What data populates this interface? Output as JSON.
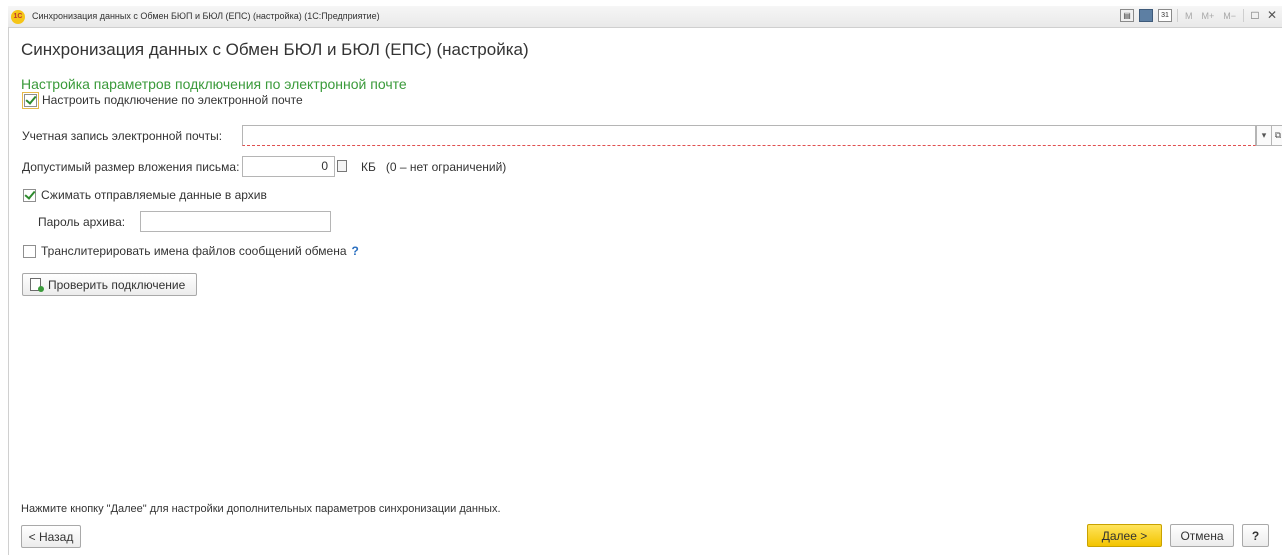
{
  "window": {
    "title": "Синхронизация данных с Обмен БЮП и БЮЛ (ЕПС) (настройка)  (1С:Предприятие)",
    "logo_text": "1C",
    "toolbar": {
      "m_label": "M",
      "m_plus_label": "M+",
      "m_minus_label": "M−"
    }
  },
  "form": {
    "title": "Синхронизация данных с Обмен БЮЛ и БЮЛ (ЕПС) (настройка)",
    "section_title": "Настройка параметров подключения по электронной почте",
    "setup_checkbox": {
      "label": "Настроить подключение по электронной почте",
      "checked": true
    },
    "account": {
      "label": "Учетная запись электронной почты:",
      "value": ""
    },
    "attachment_size": {
      "label": "Допустимый размер вложения письма:",
      "value": "0",
      "unit": "КБ",
      "note": "(0 – нет ограничений)"
    },
    "compress_checkbox": {
      "label": "Сжимать отправляемые данные в архив",
      "checked": true
    },
    "archive_password": {
      "label": "Пароль архива:",
      "value": ""
    },
    "transliterate_checkbox": {
      "label": "Транслитерировать имена файлов сообщений обмена",
      "checked": false,
      "help": "?"
    },
    "check_button": "Проверить подключение",
    "hint": "Нажмите кнопку \"Далее\" для настройки дополнительных параметров синхронизации данных."
  },
  "footer": {
    "back": "< Назад",
    "next": "Далее >",
    "cancel": "Отмена",
    "help": "?"
  },
  "colors": {
    "accent_green": "#3a9a3a",
    "next_button": "#f3c400",
    "help_blue": "#2a6fc0"
  }
}
